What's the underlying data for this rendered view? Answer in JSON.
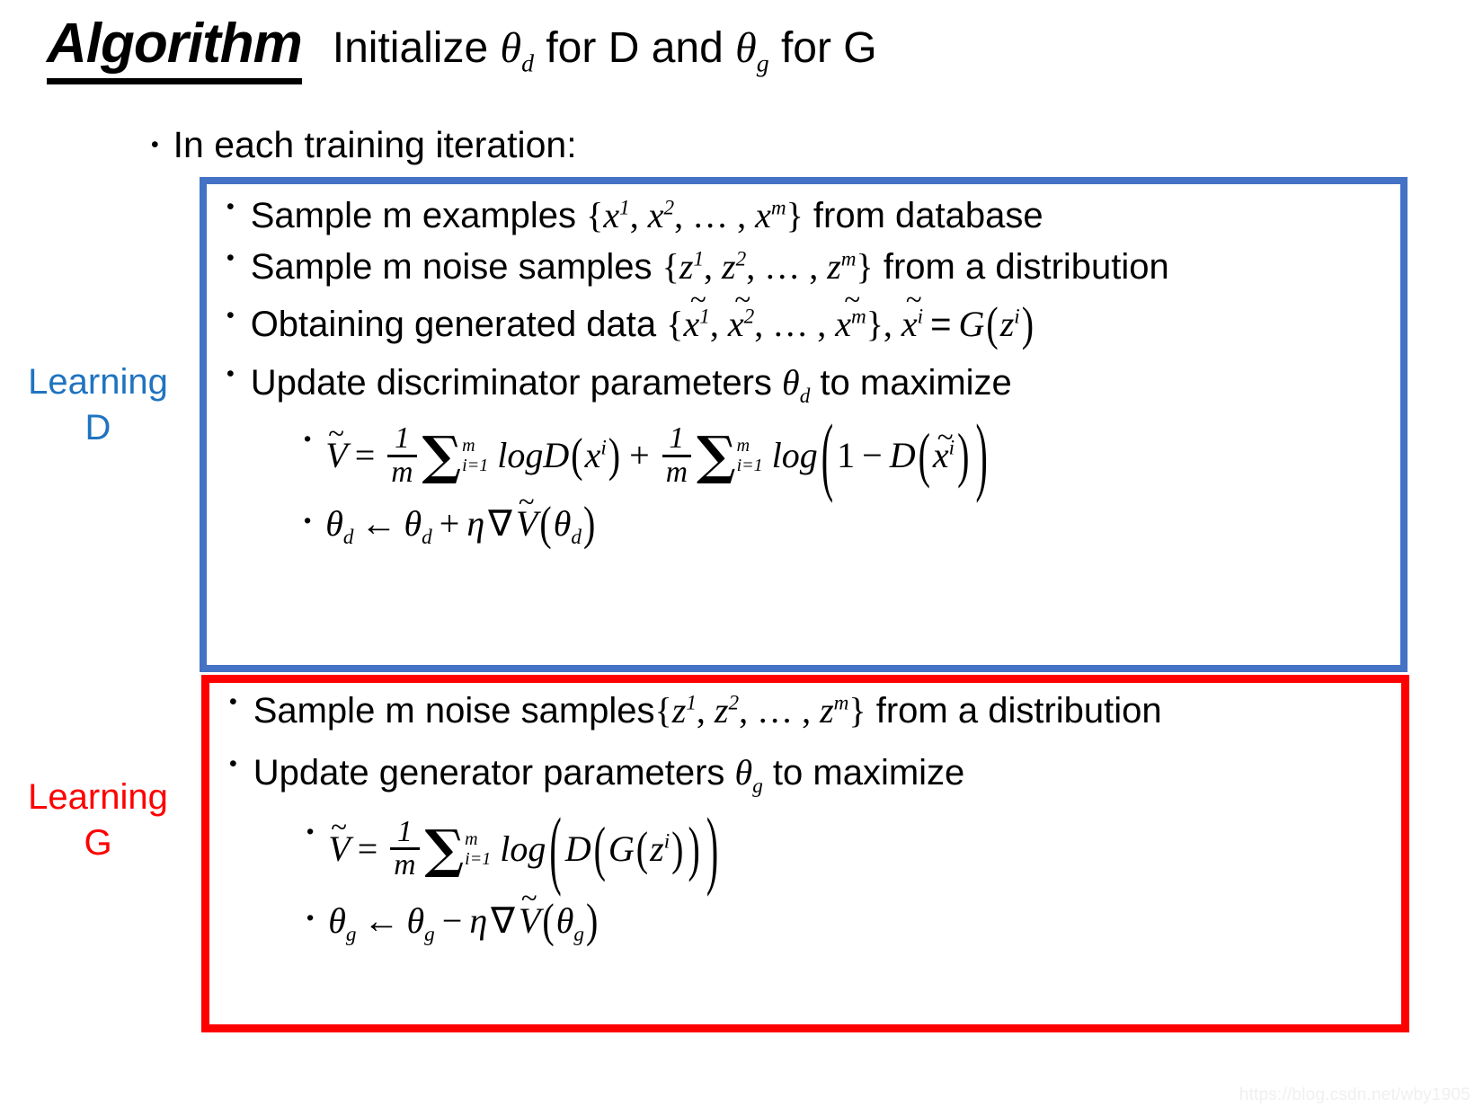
{
  "slide": {
    "title_main": "Algorithm",
    "title_tail_pre": "Initialize ",
    "title_theta_d": "θ",
    "title_theta_d_sub": "d",
    "title_mid": " for D and ",
    "title_theta_g": "θ",
    "title_theta_g_sub": "g",
    "title_end": " for G",
    "title_tail_plain": "Initialize θd for D and θg for G",
    "bullet_glyph": "•",
    "iteration_line": "In each training iteration:",
    "watermark": "https://blog.csdn.net/wby1905"
  },
  "labels": {
    "learning_d": "Learning\nD",
    "learning_d_line1": "Learning",
    "learning_d_line2": "D",
    "learning_g_line1": "Learning",
    "learning_g_line2": "G"
  },
  "colors": {
    "blue_box_border": "#4472c4",
    "red_box_border": "#ff0000",
    "learning_d_text": "#1f74c0",
    "learning_g_text": "#ff0000",
    "text": "#000000",
    "background": "#ffffff",
    "watermark": "#f0f0f0"
  },
  "learning_d_box": {
    "items": [
      {
        "id": "sample-examples",
        "text_plain": "Sample m examples {x¹, x², …, xᵐ} from database",
        "pre": "Sample m examples ",
        "set_open": "{",
        "sym": "x",
        "set_close": "}",
        "post": " from database"
      },
      {
        "id": "sample-noise",
        "text_plain": "Sample m noise samples {z¹, z², …, zᵐ} from a distribution",
        "pre": "Sample m noise samples ",
        "set_open": "{",
        "sym": "z",
        "set_close": "}",
        "post": " from a distribution"
      },
      {
        "id": "obtaining-generated-data",
        "text_plain": "Obtaining generated data {x̃¹, x̃², …, x̃ᵐ}, x̃ⁱ = G(zⁱ)",
        "pre": "Obtaining generated data ",
        "set_open": "{",
        "sym": "x̃",
        "set_close": "}",
        "post": ", x̃ⁱ = G(zⁱ)"
      },
      {
        "id": "update-discriminator",
        "text_plain": "Update discriminator parameters θd to maximize",
        "pre": "Update discriminator parameters ",
        "theta": "θ",
        "theta_sub": "d",
        "post": " to maximize"
      }
    ],
    "equations": [
      {
        "id": "v-tilde-d",
        "latex_plain": "Ṽ = (1/m) Σ_{i=1}^{m} logD(xⁱ) + (1/m) Σ_{i=1}^{m} log(1 − D(x̃ⁱ))",
        "V": "V",
        "tilde": "~",
        "eq": "=",
        "frac_num": "1",
        "frac_den": "m",
        "sum_top": "m",
        "sum_bot": "i=1",
        "log": "log",
        "D": "D",
        "x": "x",
        "sup_i": "i",
        "plus": "+",
        "one": "1",
        "minus": "−"
      },
      {
        "id": "theta-d-update",
        "latex_plain": "θd ← θd + η∇Ṽ(θd)",
        "theta": "θ",
        "sub": "d",
        "arrow": "←",
        "op": "+",
        "eta": "η",
        "nabla": "∇",
        "V": "V",
        "tilde": "~"
      }
    ]
  },
  "learning_g_box": {
    "items": [
      {
        "id": "sample-noise-g",
        "text_plain": "Sample m noise samples{z¹, z², …, zᵐ} from a distribution",
        "pre": "Sample m noise samples",
        "set_open": "{",
        "sym": "z",
        "set_close": "}",
        "post": " from a distribution"
      },
      {
        "id": "update-generator",
        "text_plain": "Update generator parameters θg to maximize",
        "pre": "Update generator parameters ",
        "theta": "θ",
        "theta_sub": "g",
        "post": " to maximize"
      }
    ],
    "equations": [
      {
        "id": "v-tilde-g",
        "latex_plain": "Ṽ = (1/m) Σ_{i=1}^{m} log(D(G(zⁱ)))",
        "V": "V",
        "tilde": "~",
        "eq": "=",
        "frac_num": "1",
        "frac_den": "m",
        "sum_top": "m",
        "sum_bot": "i=1",
        "log": "log",
        "D": "D",
        "G": "G",
        "z": "z",
        "sup_i": "i"
      },
      {
        "id": "theta-g-update",
        "latex_plain": "θg ← θg − η∇Ṽ(θg)",
        "theta": "θ",
        "sub": "g",
        "arrow": "←",
        "op": "−",
        "eta": "η",
        "nabla": "∇",
        "V": "V",
        "tilde": "~"
      }
    ]
  },
  "math_tokens": {
    "sup_1": "1",
    "sup_2": "2",
    "sup_m": "m",
    "sup_i": "i",
    "ellipsis": ", … ,",
    "comma": ",",
    "sigma": "∑"
  }
}
